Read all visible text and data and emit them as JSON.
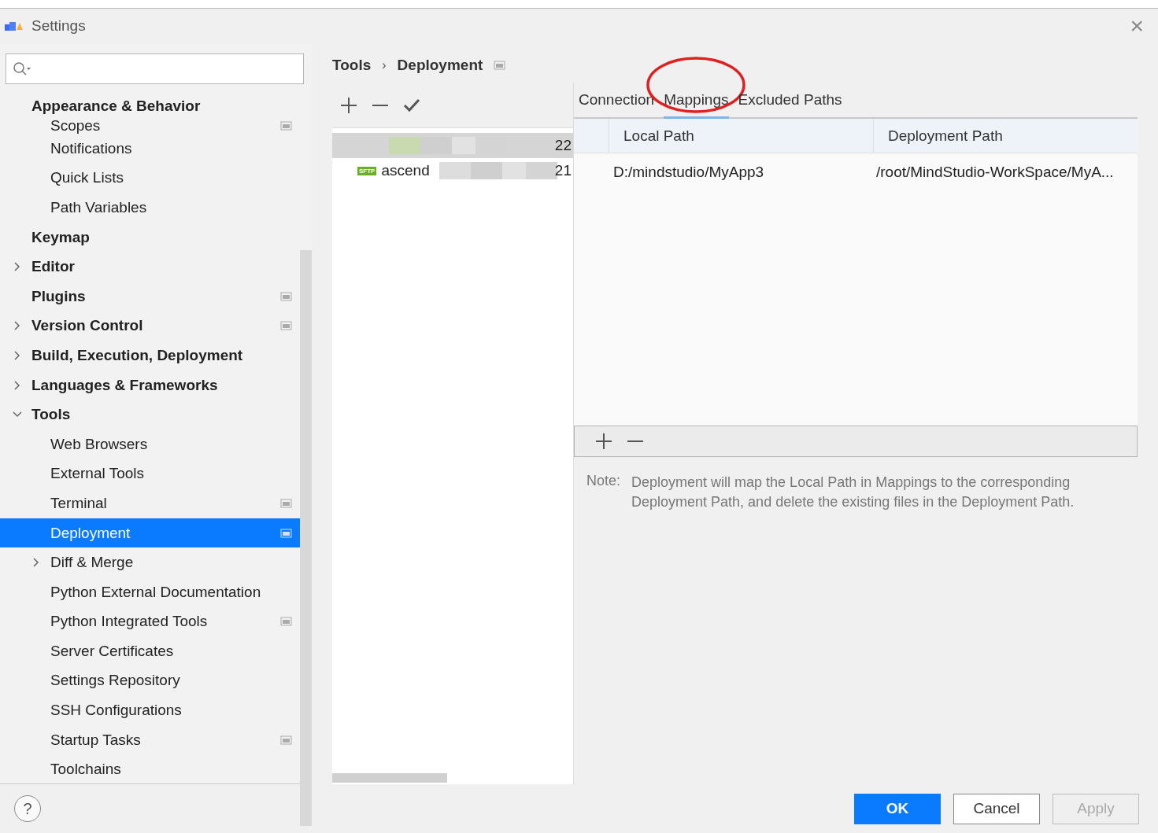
{
  "window": {
    "title": "Settings",
    "close": "×"
  },
  "tree": [
    {
      "label": "Appearance & Behavior",
      "children": [
        {
          "label": "Scopes",
          "project_level": true
        },
        {
          "label": "Notifications"
        },
        {
          "label": "Quick Lists"
        },
        {
          "label": "Path Variables"
        }
      ]
    },
    {
      "label": "Keymap"
    },
    {
      "label": "Editor",
      "expanded": false
    },
    {
      "label": "Plugins",
      "project_level": true
    },
    {
      "label": "Version Control",
      "expanded": false,
      "project_level": true
    },
    {
      "label": "Build, Execution, Deployment",
      "expanded": false
    },
    {
      "label": "Languages & Frameworks",
      "expanded": false
    },
    {
      "label": "Tools",
      "expanded": true,
      "children": [
        {
          "label": "Web Browsers"
        },
        {
          "label": "External Tools"
        },
        {
          "label": "Terminal",
          "project_level": true
        },
        {
          "label": "Deployment",
          "project_level": true,
          "selected": true
        },
        {
          "label": "Diff & Merge",
          "expanded": false
        },
        {
          "label": "Python External Documentation"
        },
        {
          "label": "Python Integrated Tools",
          "project_level": true
        },
        {
          "label": "Server Certificates"
        },
        {
          "label": "Settings Repository"
        },
        {
          "label": "SSH Configurations"
        },
        {
          "label": "Startup Tasks",
          "project_level": true
        },
        {
          "label": "Toolchains"
        }
      ]
    }
  ],
  "breadcrumb": [
    "Tools",
    "Deployment"
  ],
  "breadcrumb_separator": "›",
  "servers": [
    {
      "suffix": "22",
      "selected": true
    },
    {
      "badge": "SFTP",
      "name": "ascend",
      "suffix": "21",
      "selected": false
    }
  ],
  "tabs": [
    {
      "label": "Connection",
      "selected": false,
      "circled": false
    },
    {
      "label": "Mappings",
      "selected": true,
      "circled": true
    },
    {
      "label": "Excluded Paths",
      "selected": false,
      "circled": false
    }
  ],
  "mappings": {
    "columns": [
      "Local Path",
      "Deployment Path"
    ],
    "rows": [
      [
        "D:/mindstudio/MyApp3",
        "/root/MindStudio-WorkSpace/MyA..."
      ]
    ]
  },
  "note": {
    "label": "Note:",
    "text": "Deployment will map the Local Path in Mappings to the corresponding Deployment Path, and delete the existing files in the Deployment Path."
  },
  "help": "?",
  "buttons": [
    {
      "label": "OK",
      "kind": "primary"
    },
    {
      "label": "Cancel",
      "kind": "normal"
    },
    {
      "label": "Apply",
      "kind": "disabled"
    }
  ]
}
